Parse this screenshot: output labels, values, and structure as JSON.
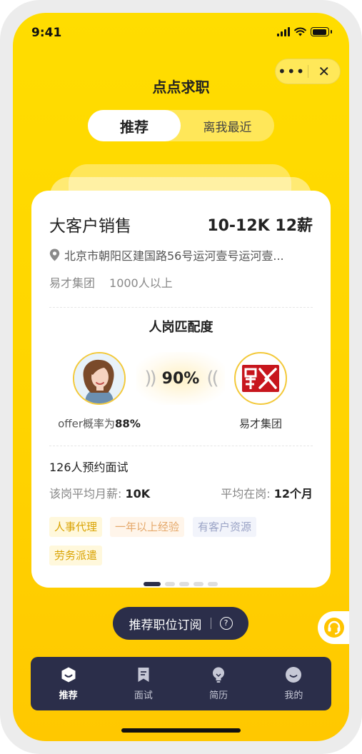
{
  "status_bar": {
    "time": "9:41"
  },
  "nav": {
    "title": "点点求职",
    "more_icon": "ellipsis-icon",
    "close_icon": "close-icon"
  },
  "segmented": {
    "active": "推荐",
    "inactive": "离我最近"
  },
  "job": {
    "title": "大客户销售",
    "salary": "10-12K 12薪",
    "address": "北京市朝阳区建国路56号运河壹号运河壹...",
    "company": "易才集团",
    "company_size": "1000人以上"
  },
  "match": {
    "title": "人岗匹配度",
    "percent": "90%",
    "offer_prefix": "offer概率为",
    "offer_value": "88%",
    "company_name": "易才集团"
  },
  "stats": {
    "appointments": "126人预约面试",
    "avg_salary_label": "该岗平均月薪:",
    "avg_salary_value": "10K",
    "avg_tenure_label": "平均在岗:",
    "avg_tenure_value": "12个月"
  },
  "tags": [
    "人事代理",
    "一年以上经验",
    "有客户资源",
    "劳务派遣"
  ],
  "pagination": {
    "current": 1,
    "total": 5
  },
  "subscribe": {
    "label": "推荐职位订阅",
    "help_glyph": "?"
  },
  "tabbar": [
    {
      "label": "推荐",
      "icon": "smile-icon",
      "active": true
    },
    {
      "label": "面试",
      "icon": "bookmark-icon",
      "active": false
    },
    {
      "label": "简历",
      "icon": "lightbulb-icon",
      "active": false
    },
    {
      "label": "我的",
      "icon": "profile-icon",
      "active": false
    }
  ],
  "colors": {
    "primary_yellow": "#ffd400",
    "navy": "#2b2e4a",
    "accent_border": "#f3c93a"
  }
}
